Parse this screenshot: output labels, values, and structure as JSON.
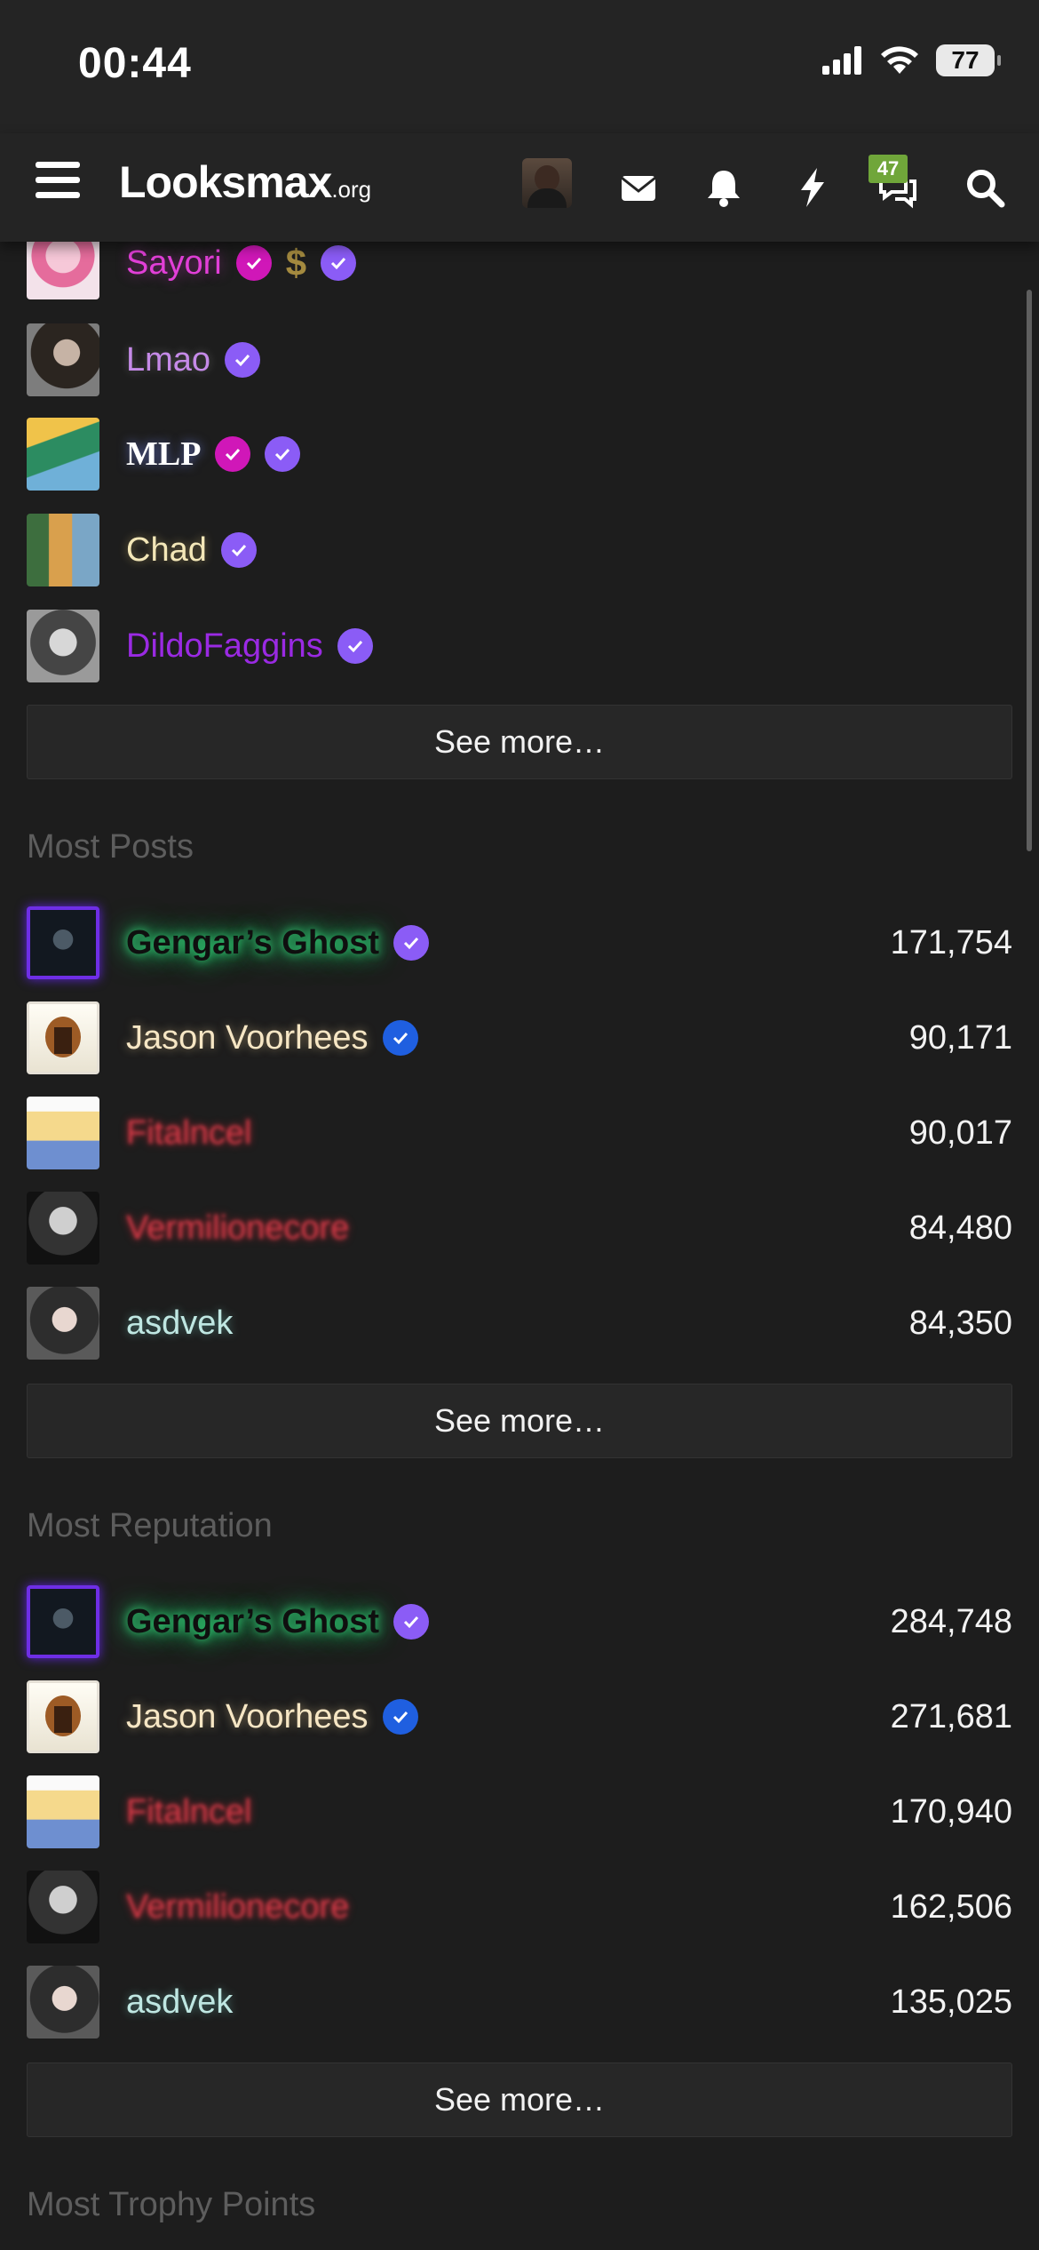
{
  "status_bar": {
    "time": "00:44",
    "battery": "77"
  },
  "nav": {
    "logo_main": "Looksmax",
    "logo_suffix": ".org",
    "conversations_badge": "47",
    "icons": [
      "menu-icon",
      "user-avatar",
      "mail-icon",
      "bell-icon",
      "bolt-icon",
      "chat-icon",
      "search-icon"
    ]
  },
  "top_list": {
    "members": [
      {
        "name": "Sayori"
      },
      {
        "name": "Lmao"
      },
      {
        "name": "MLP"
      },
      {
        "name": "Chad"
      },
      {
        "name": "DildoFaggins"
      }
    ],
    "see_more": "See more…"
  },
  "most_posts": {
    "title": "Most Posts",
    "members": [
      {
        "name": "Gengar’s Ghost",
        "value": "171,754"
      },
      {
        "name": "Jason Voorhees",
        "value": "90,171"
      },
      {
        "name": "Fitalncel",
        "value": "90,017"
      },
      {
        "name": "Vermilionecore",
        "value": "84,480"
      },
      {
        "name": "asdvek",
        "value": "84,350"
      }
    ],
    "see_more": "See more…"
  },
  "most_reputation": {
    "title": "Most Reputation",
    "members": [
      {
        "name": "Gengar’s Ghost",
        "value": "284,748"
      },
      {
        "name": "Jason Voorhees",
        "value": "271,681"
      },
      {
        "name": "Fitalncel",
        "value": "170,940"
      },
      {
        "name": "Vermilionecore",
        "value": "162,506"
      },
      {
        "name": "asdvek",
        "value": "135,025"
      }
    ],
    "see_more": "See more…"
  },
  "most_trophy_points": {
    "title": "Most Trophy Points"
  },
  "colors": {
    "background": "#1d1d1d",
    "header": "#242424",
    "verified_purple": "#8b5cf6",
    "verified_magenta": "#d017b8",
    "verified_blue": "#1f5fe0",
    "badge_green": "#70a63a"
  }
}
